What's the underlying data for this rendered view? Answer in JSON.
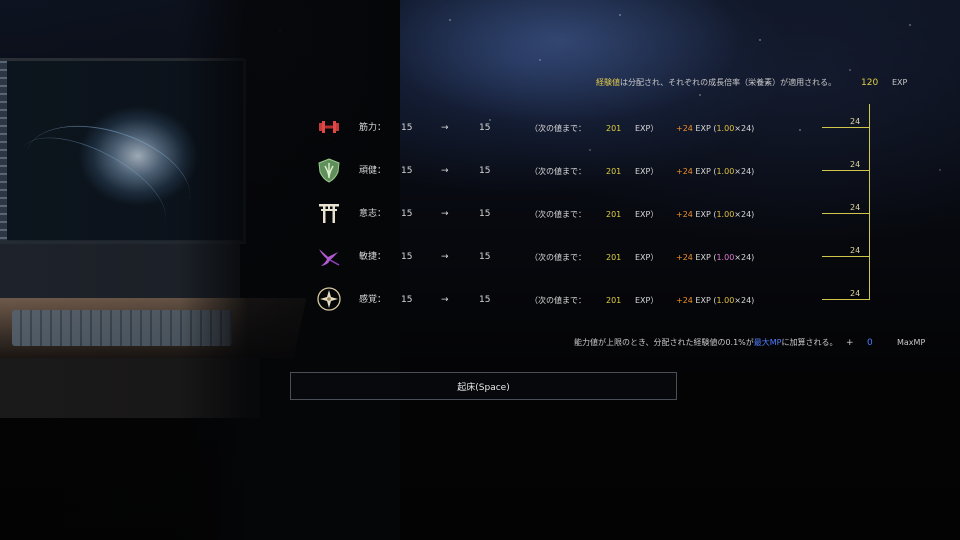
{
  "header": {
    "info_highlight": "経験値",
    "info_rest": "は分配され、それぞれの成長倍率（栄養素）が適用される。",
    "exp_value": "120",
    "exp_unit": "EXP"
  },
  "stats": [
    {
      "icon": "dumbbell-icon",
      "name": "筋力：",
      "current": "15",
      "arrow": "→",
      "new": "15",
      "next_label": "（次の値まで：",
      "next_value": "201",
      "next_unit": "EXP）",
      "gain": "+24",
      "gain_unit": " EXP (",
      "multiplier": "1.00",
      "times": "×24)",
      "graph_label": "24"
    },
    {
      "icon": "shield-icon",
      "name": "頑健：",
      "current": "15",
      "arrow": "→",
      "new": "15",
      "next_label": "（次の値まで：",
      "next_value": "201",
      "next_unit": "EXP）",
      "gain": "+24",
      "gain_unit": " EXP (",
      "multiplier": "1.00",
      "times": "×24)",
      "graph_label": "24"
    },
    {
      "icon": "torii-gate-icon",
      "name": "意志：",
      "current": "15",
      "arrow": "→",
      "new": "15",
      "next_label": "（次の値まで：",
      "next_value": "201",
      "next_unit": "EXP）",
      "gain": "+24",
      "gain_unit": " EXP (",
      "multiplier": "1.00",
      "times": "×24)",
      "graph_label": "24"
    },
    {
      "icon": "swallow-bird-icon",
      "name": "敏捷：",
      "current": "15",
      "arrow": "→",
      "new": "15",
      "next_label": "（次の値まで：",
      "next_value": "201",
      "next_unit": "EXP）",
      "gain": "+24",
      "gain_unit": " EXP (",
      "multiplier": "1.00",
      "times": "×24)",
      "graph_label": "24"
    },
    {
      "icon": "compass-star-icon",
      "name": "感覚：",
      "current": "15",
      "arrow": "→",
      "new": "15",
      "next_label": "（次の値まで：",
      "next_value": "201",
      "next_unit": "EXP）",
      "gain": "+24",
      "gain_unit": " EXP (",
      "multiplier": "1.00",
      "times": "×24)",
      "graph_label": "24"
    }
  ],
  "footer": {
    "note_a": "能力値が上限のとき、分配された経験値の0.1%が",
    "note_highlight": "最大MP",
    "note_b": "に加算される。",
    "plus": "+",
    "mp_value": "0",
    "mp_unit": "MaxMP"
  },
  "wake_button": {
    "label": "起床(Space)"
  },
  "colors": {
    "accent_yellow": "#e0d040",
    "accent_orange": "#f0902a",
    "accent_blue": "#4f7fff",
    "accent_pink": "#e07ad0"
  }
}
